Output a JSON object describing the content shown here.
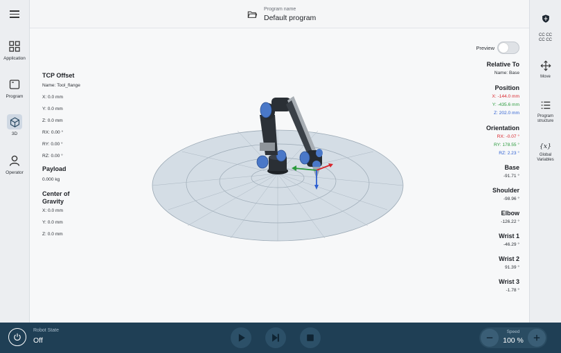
{
  "header": {
    "program_caption": "Program name",
    "program_name": "Default program"
  },
  "left_nav": [
    {
      "label": "Application",
      "icon": "grid-icon"
    },
    {
      "label": "Program",
      "icon": "window-icon"
    },
    {
      "label": "3D",
      "icon": "cube-icon"
    },
    {
      "label": "Operator",
      "icon": "person-icon"
    }
  ],
  "right_nav": {
    "cc_line1": "CC CC",
    "cc_line2": "CC CC",
    "move": "Move",
    "program_structure_1": "Program",
    "program_structure_2": "structure",
    "global_vars_symbol": "{x}",
    "global_vars_1": "Global",
    "global_vars_2": "Variables"
  },
  "preview": {
    "label": "Preview",
    "enabled": false
  },
  "tcp": {
    "title": "TCP Offset",
    "name": "Name: Tool_flange",
    "x": "X: 0.0 mm",
    "y": "Y: 0.0 mm",
    "z": "Z: 0.0 mm",
    "rx": "RX: 0.00 °",
    "ry": "RY: 0.00 °",
    "rz": "RZ: 0.00 °"
  },
  "payload": {
    "title": "Payload",
    "value": "0.000 kg"
  },
  "cog": {
    "title_1": "Center of",
    "title_2": "Gravity",
    "x": "X: 0.0 mm",
    "y": "Y: 0.0 mm",
    "z": "Z: 0.0 mm"
  },
  "relative": {
    "title": "Relative To",
    "name": "Name: Base"
  },
  "position": {
    "title": "Position",
    "x": "X: -144.0 mm",
    "y": "Y: -435.6 mm",
    "z": "Z: 202.0 mm"
  },
  "orientation": {
    "title": "Orientation",
    "rx": "RX: -0.07 °",
    "ry": "RY: 178.55 °",
    "rz": "RZ: 2.23 °"
  },
  "joints": [
    {
      "name": "Base",
      "value": "-91.71 °"
    },
    {
      "name": "Shoulder",
      "value": "-98.96 °"
    },
    {
      "name": "Elbow",
      "value": "-126.22 °"
    },
    {
      "name": "Wrist 1",
      "value": "-46.29 °"
    },
    {
      "name": "Wrist 2",
      "value": "91.39 °"
    },
    {
      "name": "Wrist 3",
      "value": "-1.78 °"
    }
  ],
  "bottom": {
    "robot_state_label": "Robot State",
    "robot_state": "Off",
    "speed_label": "Speed",
    "speed_value": "100 %"
  },
  "colors": {
    "x_axis": "#d8262c",
    "y_axis": "#2a9a3c",
    "z_axis": "#2d5fd1",
    "bottom_bar": "#1f3f55",
    "robot_joint_blue": "#4a78c8"
  }
}
